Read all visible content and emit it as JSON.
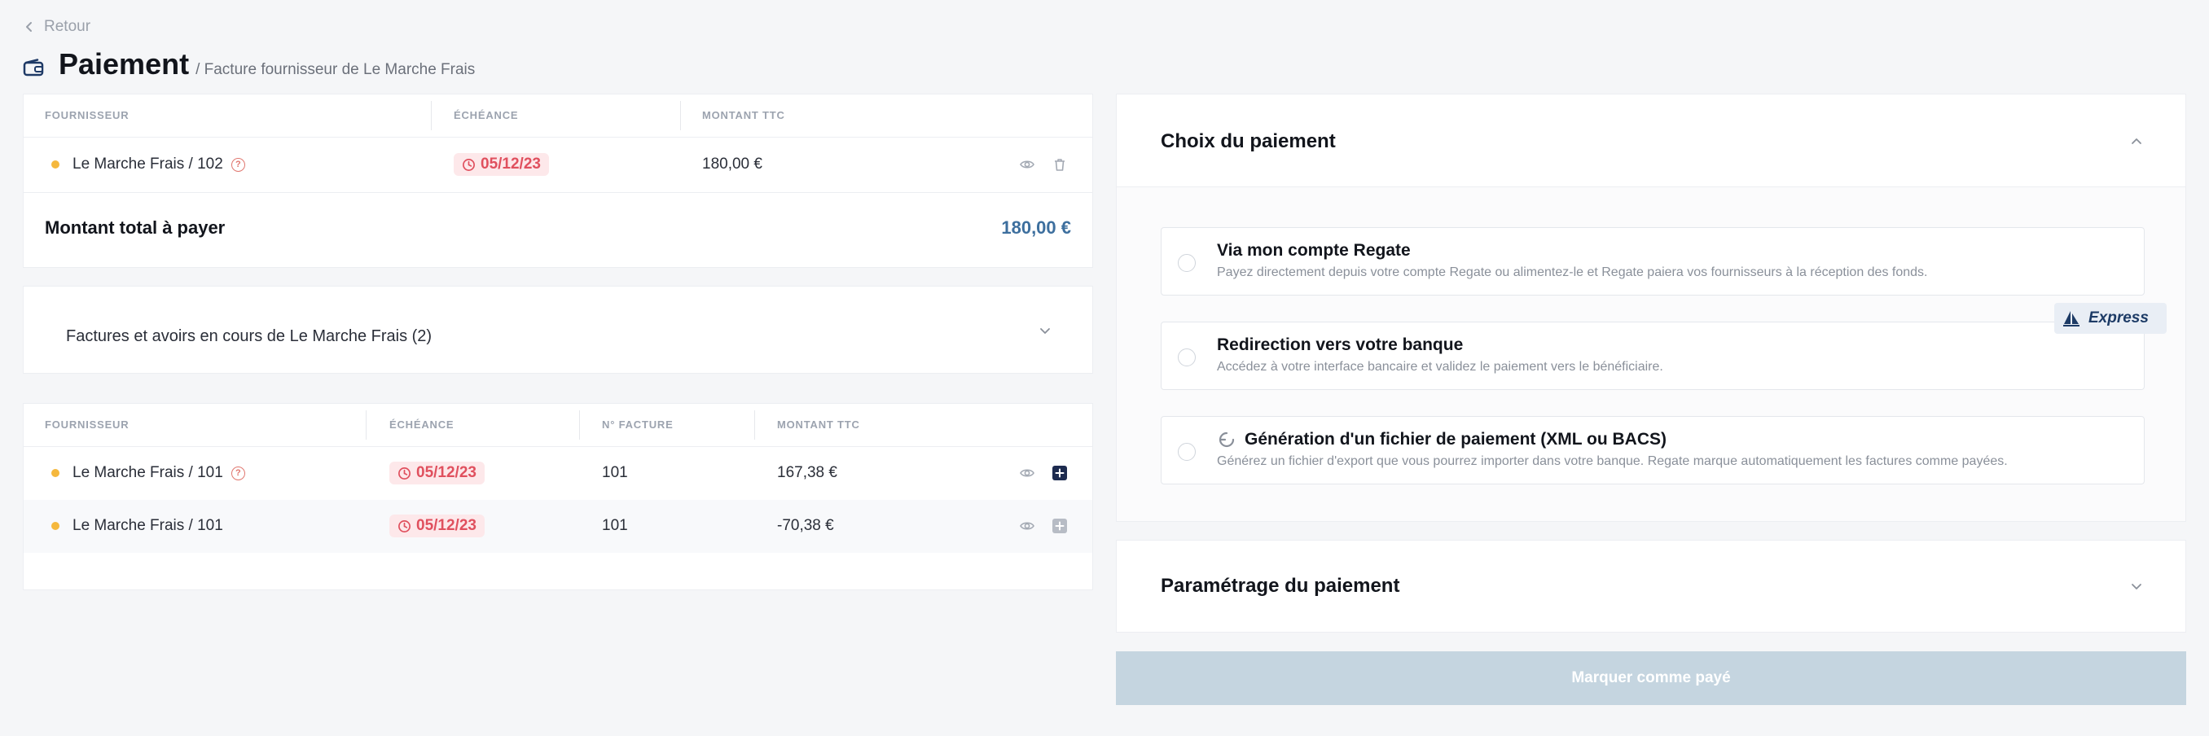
{
  "header": {
    "back_label": "Retour",
    "title": "Paiement",
    "subtitle": "/ Facture fournisseur de Le Marche Frais"
  },
  "selected_invoice": {
    "columns": [
      "FOURNISSEUR",
      "ÉCHÉANCE",
      "MONTANT TTC"
    ],
    "row": {
      "supplier": "Le Marche Frais / 102",
      "due_date": "05/12/23",
      "amount": "180,00 €"
    },
    "total_label": "Montant total à payer",
    "total_value": "180,00 €"
  },
  "pending": {
    "accordion_label": "Factures et avoirs en cours de Le Marche Frais (2)",
    "columns": [
      "FOURNISSEUR",
      "ÉCHÉANCE",
      "N° FACTURE",
      "MONTANT TTC"
    ],
    "rows": [
      {
        "supplier": "Le Marche Frais / 101",
        "due_date": "05/12/23",
        "invoice_no": "101",
        "amount": "167,38 €"
      },
      {
        "supplier": "Le Marche Frais / 101",
        "due_date": "05/12/23",
        "invoice_no": "101",
        "amount": "-70,38 €"
      }
    ]
  },
  "payment_choice": {
    "title": "Choix du paiement",
    "options": [
      {
        "title": "Via mon compte Regate",
        "description": "Payez directement depuis votre compte Regate ou alimentez-le et Regate paiera vos fournisseurs à la réception des fonds."
      },
      {
        "title": "Redirection vers votre banque",
        "description": "Accédez à votre interface bancaire et validez le paiement vers le bénéficiaire.",
        "badge": "Express"
      },
      {
        "title": "Génération d'un fichier de paiement (XML ou BACS)",
        "description": "Générez un fichier d'export que vous pourrez importer dans votre banque. Regate marque automatiquement les factures comme payées."
      }
    ]
  },
  "payment_settings": {
    "title": "Paramétrage du paiement"
  },
  "submit_label": "Marquer comme payé",
  "colors": {
    "accent": "#3d6f9e",
    "due_badge_bg": "#fde8ea",
    "due_badge_text": "#e0505e",
    "status_dot": "#f5b83d",
    "submit_disabled": "#c5d5e0"
  }
}
